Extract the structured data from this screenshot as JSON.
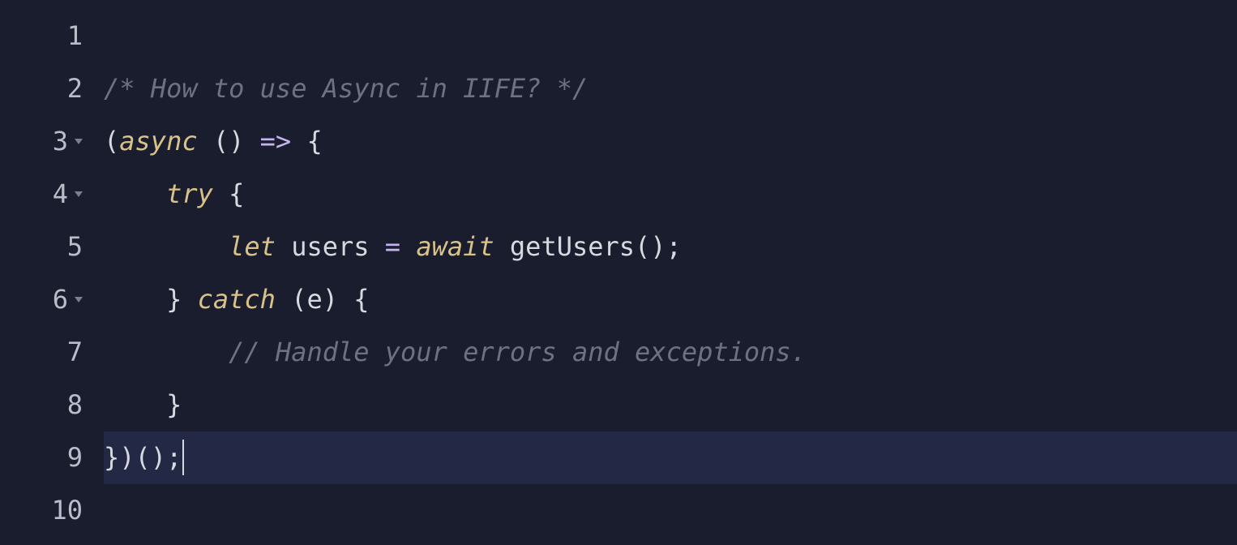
{
  "editor": {
    "language": "javascript",
    "activeLine": 9,
    "lines": [
      {
        "num": 1,
        "fold": false,
        "tokens": []
      },
      {
        "num": 2,
        "fold": false,
        "tokens": [
          {
            "cls": "tok-comment",
            "text": "/* How to use Async in IIFE? */"
          }
        ]
      },
      {
        "num": 3,
        "fold": true,
        "tokens": [
          {
            "cls": "tok-punct",
            "text": "("
          },
          {
            "cls": "tok-keyword",
            "text": "async"
          },
          {
            "cls": "tok-punct",
            "text": " () "
          },
          {
            "cls": "tok-op",
            "text": "=>"
          },
          {
            "cls": "tok-punct",
            "text": " {"
          }
        ]
      },
      {
        "num": 4,
        "fold": true,
        "tokens": [
          {
            "cls": "guide",
            "text": "    "
          },
          {
            "cls": "tok-keyword",
            "text": "try"
          },
          {
            "cls": "tok-punct",
            "text": " {"
          }
        ]
      },
      {
        "num": 5,
        "fold": false,
        "tokens": [
          {
            "cls": "guide",
            "text": "    "
          },
          {
            "cls": "tok-punct",
            "text": "    "
          },
          {
            "cls": "tok-storage",
            "text": "let"
          },
          {
            "cls": "tok-ident",
            "text": " users "
          },
          {
            "cls": "tok-op",
            "text": "="
          },
          {
            "cls": "tok-ident",
            "text": " "
          },
          {
            "cls": "tok-keyword",
            "text": "await"
          },
          {
            "cls": "tok-ident",
            "text": " "
          },
          {
            "cls": "tok-func",
            "text": "getUsers"
          },
          {
            "cls": "tok-punct",
            "text": "();"
          }
        ]
      },
      {
        "num": 6,
        "fold": true,
        "tokens": [
          {
            "cls": "guide",
            "text": "    "
          },
          {
            "cls": "tok-punct",
            "text": "} "
          },
          {
            "cls": "tok-keyword",
            "text": "catch"
          },
          {
            "cls": "tok-punct",
            "text": " (e) {"
          }
        ]
      },
      {
        "num": 7,
        "fold": false,
        "tokens": [
          {
            "cls": "guide",
            "text": "    "
          },
          {
            "cls": "tok-punct",
            "text": "    "
          },
          {
            "cls": "tok-comment",
            "text": "// Handle your errors and exceptions."
          }
        ]
      },
      {
        "num": 8,
        "fold": false,
        "tokens": [
          {
            "cls": "guide",
            "text": "    "
          },
          {
            "cls": "tok-punct",
            "text": "}"
          }
        ]
      },
      {
        "num": 9,
        "fold": false,
        "tokens": [
          {
            "cls": "tok-punct",
            "text": "})();"
          }
        ]
      },
      {
        "num": 10,
        "fold": false,
        "tokens": []
      }
    ]
  }
}
